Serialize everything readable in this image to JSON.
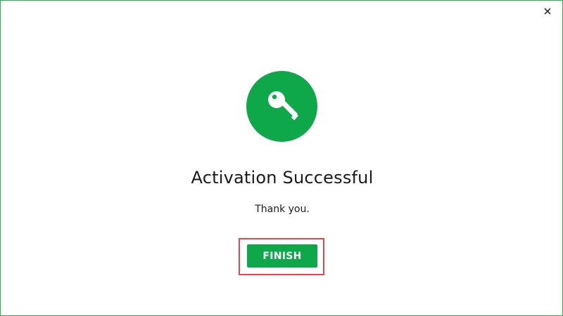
{
  "dialog": {
    "close_icon": "close-icon",
    "badge_icon": "key-icon",
    "title": "Activation Successful",
    "message": "Thank you.",
    "finish_label": "FINISH"
  },
  "colors": {
    "accent": "#0ea84a",
    "border": "#2bb24c",
    "highlight": "#e8474b",
    "text": "#1a1a1a"
  }
}
